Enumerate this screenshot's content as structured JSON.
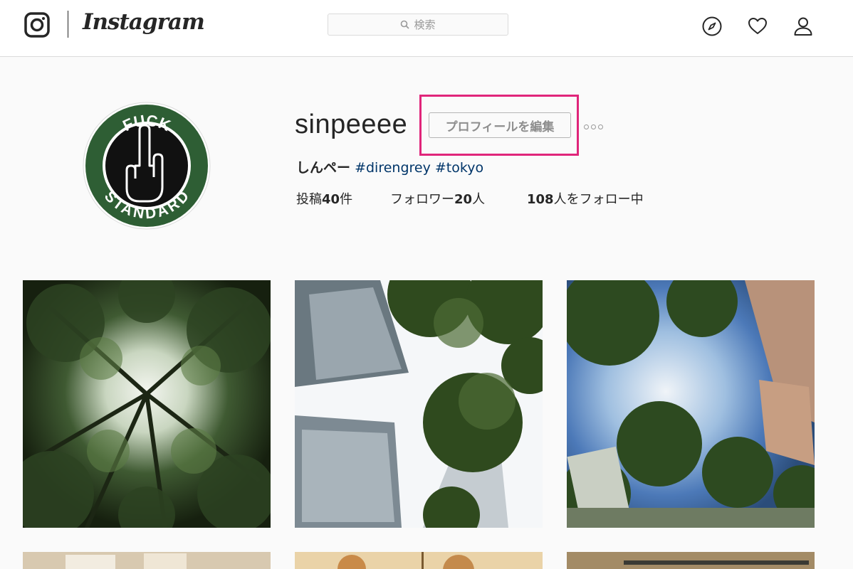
{
  "header": {
    "logo_text": "Instagram",
    "search_placeholder": "検索",
    "icons": [
      "compass-icon",
      "heart-icon",
      "user-icon"
    ]
  },
  "profile": {
    "username": "sinpeeee",
    "edit_button_label": "プロフィールを編集",
    "more_label": "°°°",
    "full_name": "しんペー",
    "hashtags": [
      "#direngrey",
      "#tokyo"
    ],
    "avatar_text_top": "FUCK",
    "avatar_text_bottom": "STANDARD"
  },
  "stats": {
    "posts_prefix": "投稿",
    "posts_count": "40",
    "posts_suffix": "件",
    "followers_prefix": "フォロワー",
    "followers_count": "20",
    "followers_suffix": "人",
    "following_count": "108",
    "following_suffix": "人をフォロー中"
  },
  "colors": {
    "highlight": "#e0257a",
    "hashtag": "#003569",
    "avatar_green": "#2e5e34"
  }
}
